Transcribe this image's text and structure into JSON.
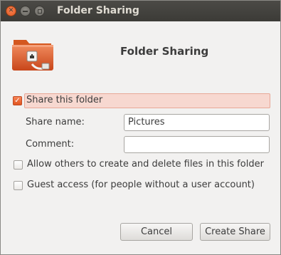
{
  "window": {
    "title": "Folder Sharing",
    "buttons": [
      "close-icon",
      "minimize-icon",
      "maximize-icon"
    ]
  },
  "header": {
    "title": "Folder Sharing",
    "icon": "shared-folder-icon"
  },
  "share": {
    "label": "Share this folder",
    "checked": true
  },
  "share_name": {
    "label": "Share name:",
    "value": "Pictures"
  },
  "comment": {
    "label": "Comment:",
    "value": ""
  },
  "allow_others": {
    "label": "Allow others to create and delete files in this folder",
    "checked": false
  },
  "guest": {
    "label": "Guest access (for people without a user account)",
    "checked": false
  },
  "actions": {
    "cancel": "Cancel",
    "create": "Create Share"
  },
  "colors": {
    "accent": "#e0551f",
    "highlight": "#f7d8d0",
    "titlebar": "#3c3b37"
  }
}
